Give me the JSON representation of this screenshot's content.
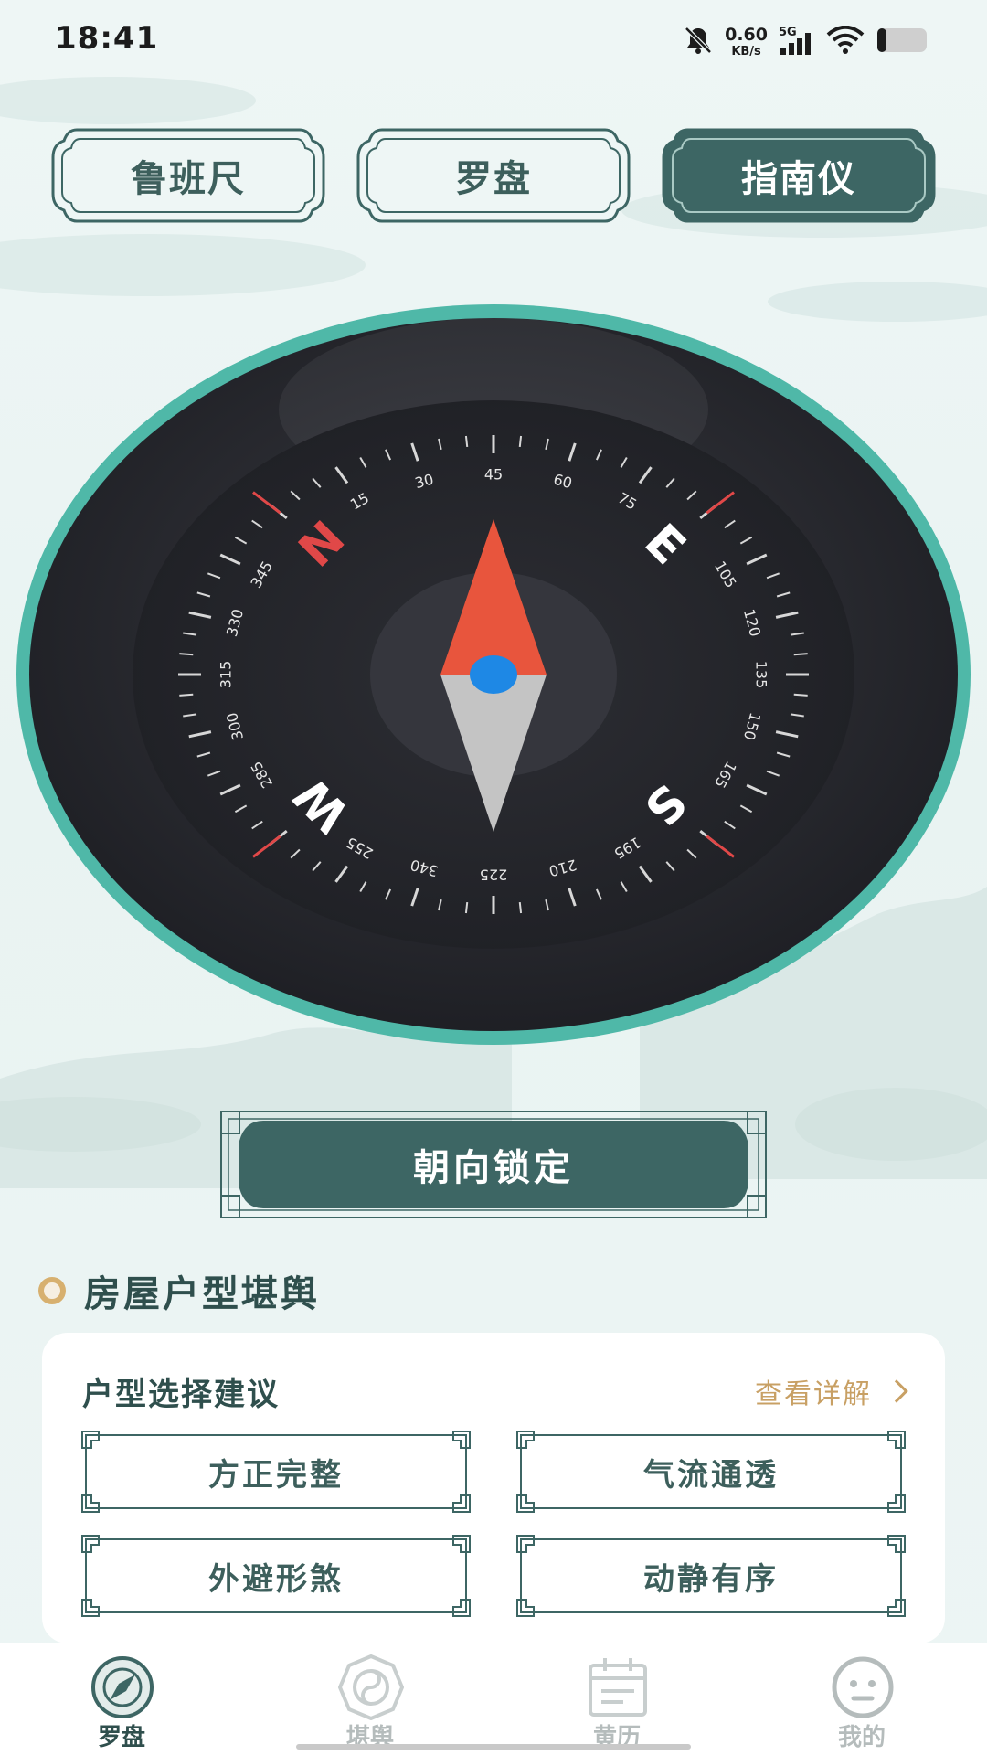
{
  "status_bar": {
    "time": "18:41",
    "net_speed_value": "0.60",
    "net_speed_unit": "KB/s",
    "network_type": "5G",
    "icons": [
      "mute-bell-icon",
      "signal-icon",
      "wifi-icon",
      "battery-icon"
    ]
  },
  "tabs": [
    {
      "label": "鲁班尺",
      "active": false
    },
    {
      "label": "罗盘",
      "active": false
    },
    {
      "label": "指南仪",
      "active": true
    }
  ],
  "compass": {
    "cardinals": [
      "N",
      "E",
      "S",
      "W"
    ],
    "degree_labels": [
      "15",
      "30",
      "45",
      "60",
      "75",
      "105",
      "120",
      "135",
      "150",
      "165",
      "195",
      "210",
      "225",
      "340",
      "255",
      "285",
      "300",
      "315",
      "330",
      "345"
    ],
    "needle_north_color": "#e8553d",
    "needle_south_color": "#c4c4c4",
    "center_dot_color": "#1e88e5"
  },
  "lock_button": {
    "label": "朝向锁定"
  },
  "section": {
    "title": "房屋户型堪舆"
  },
  "card": {
    "heading": "户型选择建议",
    "link_label": "查看详解",
    "options": [
      "方正完整",
      "气流通透",
      "外避形煞",
      "动静有序"
    ]
  },
  "bottom_nav": [
    {
      "label": "罗盘",
      "icon": "compass-icon",
      "active": true
    },
    {
      "label": "堪舆",
      "icon": "bagua-icon",
      "active": false
    },
    {
      "label": "黄历",
      "icon": "calendar-icon",
      "active": false
    },
    {
      "label": "我的",
      "icon": "face-icon",
      "active": false
    }
  ],
  "colors": {
    "accent": "#3d6664",
    "teal_ring": "#4fb8a8",
    "gold": "#c8a064"
  }
}
